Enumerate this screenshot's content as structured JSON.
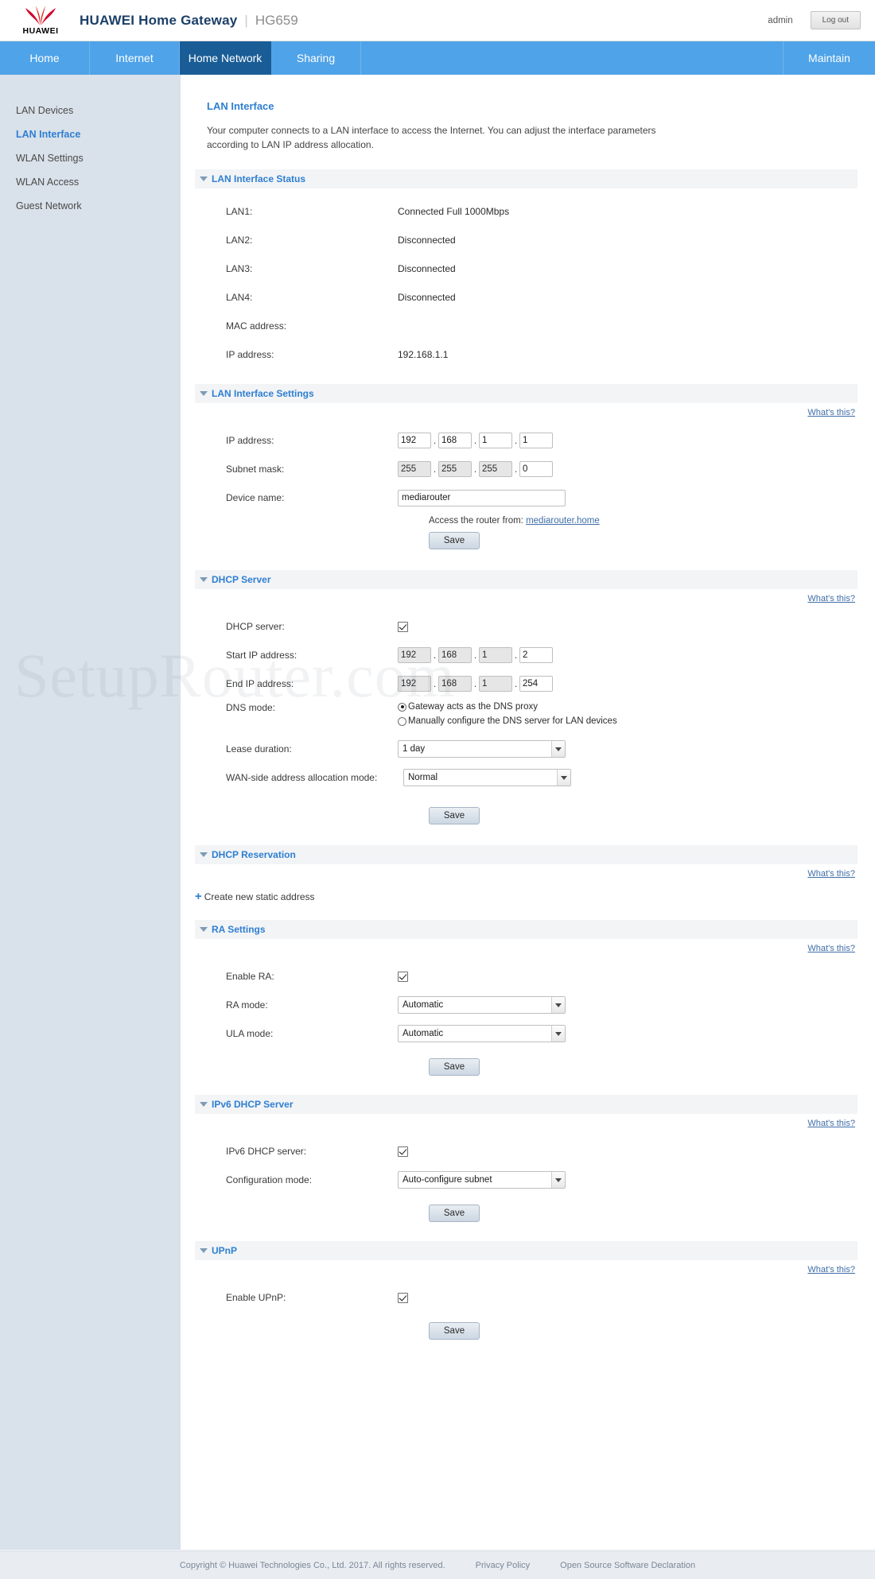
{
  "header": {
    "logo_text": "HUAWEI",
    "brand": "HUAWEI Home Gateway",
    "separator": "|",
    "model": "HG659",
    "user": "admin",
    "logout_label": "Log out"
  },
  "nav": {
    "items": [
      {
        "label": "Home",
        "active": false
      },
      {
        "label": "Internet",
        "active": false
      },
      {
        "label": "Home Network",
        "active": true
      },
      {
        "label": "Sharing",
        "active": false
      },
      {
        "label": "Maintain",
        "active": false
      }
    ]
  },
  "sidebar": {
    "items": [
      {
        "label": "LAN Devices",
        "active": false
      },
      {
        "label": "LAN Interface",
        "active": true
      },
      {
        "label": "WLAN Settings",
        "active": false
      },
      {
        "label": "WLAN Access",
        "active": false
      },
      {
        "label": "Guest Network",
        "active": false
      }
    ]
  },
  "main": {
    "title": "LAN Interface",
    "description": "Your computer connects to a LAN interface to access the Internet. You can adjust the interface parameters according to LAN IP address allocation.",
    "whats_this": "What's this?",
    "save_label": "Save",
    "watermark": "SetupRouter.com",
    "lan_status": {
      "section_title": "LAN Interface Status",
      "rows": [
        {
          "label": "LAN1:",
          "value": "Connected Full 1000Mbps"
        },
        {
          "label": "LAN2:",
          "value": "Disconnected"
        },
        {
          "label": "LAN3:",
          "value": "Disconnected"
        },
        {
          "label": "LAN4:",
          "value": "Disconnected"
        },
        {
          "label": "MAC address:",
          "value": ""
        },
        {
          "label": "IP address:",
          "value": "192.168.1.1"
        }
      ]
    },
    "lan_settings": {
      "section_title": "LAN Interface Settings",
      "ip_label": "IP address:",
      "ip_octets": [
        "192",
        "168",
        "1",
        "1"
      ],
      "mask_label": "Subnet mask:",
      "mask_octets": [
        "255",
        "255",
        "255",
        "0"
      ],
      "device_name_label": "Device name:",
      "device_name_value": "mediarouter",
      "access_prefix": "Access the router from:",
      "access_link": "mediarouter.home"
    },
    "dhcp_server": {
      "section_title": "DHCP Server",
      "enable_label": "DHCP server:",
      "enable_checked": true,
      "start_label": "Start IP address:",
      "start_octets": [
        "192",
        "168",
        "1",
        "2"
      ],
      "end_label": "End IP address:",
      "end_octets": [
        "192",
        "168",
        "1",
        "254"
      ],
      "dns_mode_label": "DNS mode:",
      "dns_option_1": "Gateway acts as the DNS proxy",
      "dns_option_2": "Manually configure the DNS server for LAN devices",
      "dns_selected": 1,
      "lease_label": "Lease duration:",
      "lease_value": "1 day",
      "wan_mode_label": "WAN-side address allocation mode:",
      "wan_mode_value": "Normal"
    },
    "dhcp_reservation": {
      "section_title": "DHCP Reservation",
      "create_label": "Create new static address"
    },
    "ra_settings": {
      "section_title": "RA Settings",
      "enable_label": "Enable RA:",
      "enable_checked": true,
      "ra_mode_label": "RA mode:",
      "ra_mode_value": "Automatic",
      "ula_mode_label": "ULA mode:",
      "ula_mode_value": "Automatic"
    },
    "ipv6_dhcp": {
      "section_title": "IPv6 DHCP Server",
      "enable_label": "IPv6 DHCP server:",
      "enable_checked": true,
      "config_mode_label": "Configuration mode:",
      "config_mode_value": "Auto-configure subnet"
    },
    "upnp": {
      "section_title": "UPnP",
      "enable_label": "Enable UPnP:",
      "enable_checked": true
    }
  },
  "footer": {
    "copyright": "Copyright © Huawei Technologies Co., Ltd. 2017. All rights reserved.",
    "privacy": "Privacy Policy",
    "opensource": "Open Source Software Declaration"
  }
}
